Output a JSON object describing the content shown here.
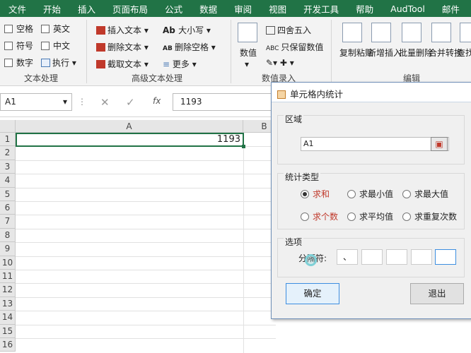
{
  "menu": [
    "文件",
    "开始",
    "插入",
    "页面布局",
    "公式",
    "数据",
    "审阅",
    "视图",
    "开发工具",
    "帮助",
    "AudTool",
    "邮件"
  ],
  "ribbon": {
    "text_group": {
      "items": [
        "空格",
        "英文",
        "符号",
        "中文",
        "数字",
        "执行"
      ],
      "label": "文本处理"
    },
    "advanced_group": {
      "items": [
        "插入文本",
        "删除文本",
        "截取文本",
        "大小写",
        "删除空格",
        "更多"
      ],
      "label": "高级文本处理"
    },
    "value_group": {
      "big": "数值",
      "items": [
        "四舍五入",
        "只保留数值"
      ],
      "label": "数值录入"
    },
    "edit_group": {
      "buttons": [
        "复制粘贴",
        "新增插入",
        "批量删除",
        "合并转换",
        "查找定位"
      ],
      "label": "编辑"
    }
  },
  "formula": {
    "namebox": "A1",
    "content": "1193"
  },
  "sheet": {
    "col_a": "A",
    "col_b": "B",
    "rows": [
      "1",
      "2",
      "3",
      "4",
      "5",
      "6",
      "7",
      "8",
      "9",
      "10",
      "11",
      "12",
      "13",
      "14",
      "15",
      "16"
    ],
    "a1_value": "1193"
  },
  "dialog": {
    "title": "单元格内统计",
    "region_label": "区域",
    "region_value": "A1",
    "stat_label": "统计类型",
    "options": [
      "求和",
      "求最小值",
      "求最大值",
      "求个数",
      "求平均值",
      "求重复次数"
    ],
    "selected": "求和",
    "extra_label": "选项",
    "separator_label": "分隔符:",
    "separators": [
      "、",
      "",
      "",
      "",
      ""
    ],
    "ok": "确定",
    "cancel": "退出"
  }
}
